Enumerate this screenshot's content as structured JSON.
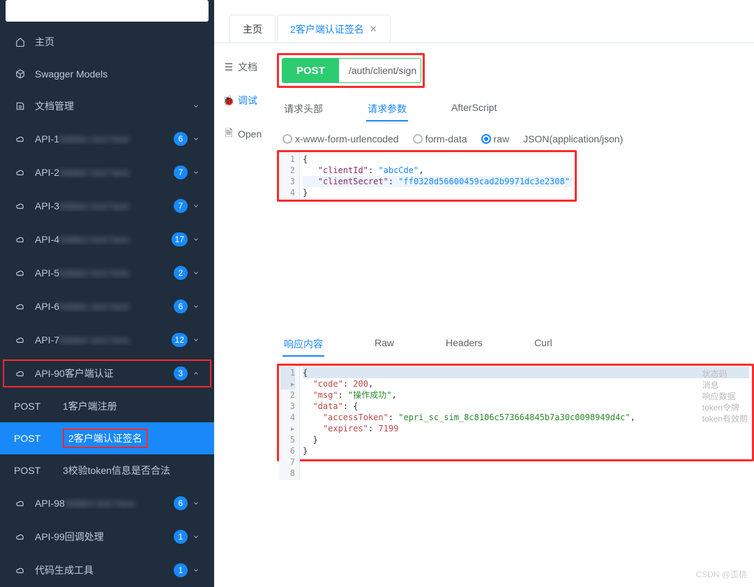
{
  "sidebar": {
    "home": "主页",
    "swagger": "Swagger Models",
    "docmgmt": "文档管理",
    "apis": [
      {
        "label": "API-1",
        "hidden": true,
        "badge": "6"
      },
      {
        "label": "API-2",
        "hidden": true,
        "badge": "7"
      },
      {
        "label": "API-3",
        "hidden": true,
        "badge": "7"
      },
      {
        "label": "API-4",
        "hidden": true,
        "badge": "17"
      },
      {
        "label": "API-5",
        "hidden": true,
        "badge": "2"
      },
      {
        "label": "API-6",
        "hidden": true,
        "badge": "6"
      },
      {
        "label": "API-7",
        "hidden": true,
        "badge": "12"
      },
      {
        "label": "API-90客户端认证",
        "hidden": false,
        "badge": "3",
        "selected": true,
        "open": true
      },
      {
        "label": "API-98",
        "hidden": true,
        "badge": "6"
      },
      {
        "label": "API-99回调处理",
        "hidden": false,
        "badge": "1"
      },
      {
        "label": "代码生成工具",
        "hidden": false,
        "badge": "1"
      }
    ],
    "subs": [
      {
        "method": "POST",
        "label": "1客户端注册"
      },
      {
        "method": "POST",
        "label": "2客户端认证签名",
        "active": true,
        "boxed": true
      },
      {
        "method": "POST",
        "label": "3校验token信息是否合法"
      }
    ]
  },
  "tabs": [
    {
      "label": "主页",
      "active": false
    },
    {
      "label": "2客户端认证签名",
      "active": true,
      "closable": true
    }
  ],
  "docnav": {
    "doc": "文档",
    "debug": "调试",
    "open": "Open"
  },
  "request": {
    "method": "POST",
    "path": "/auth/client/sign",
    "tabs": {
      "headers": "请求头部",
      "params": "请求参数",
      "afterscript": "AfterScript"
    },
    "body_types": {
      "form": "x-www-form-urlencoded",
      "formdata": "form-data",
      "raw": "raw"
    },
    "content_type": "JSON(application/json)",
    "body_json": {
      "clientId": "abcCde",
      "clientSecret": "ff0328d56600459cad2b9971dc3e2308"
    }
  },
  "response": {
    "tabs": {
      "body": "响应内容",
      "raw": "Raw",
      "headers": "Headers",
      "curl": "Curl"
    },
    "json": {
      "code": 200,
      "msg": "操作成功",
      "data": {
        "accessToken": "epri_sc_sim_8c8106c573664845b7a30c0098949d4c",
        "expires": 7199
      }
    },
    "comments": [
      "状态码",
      "消息",
      "响应数据",
      "token令牌",
      "token有效期"
    ]
  },
  "watermark": "CSDN @歪桃"
}
